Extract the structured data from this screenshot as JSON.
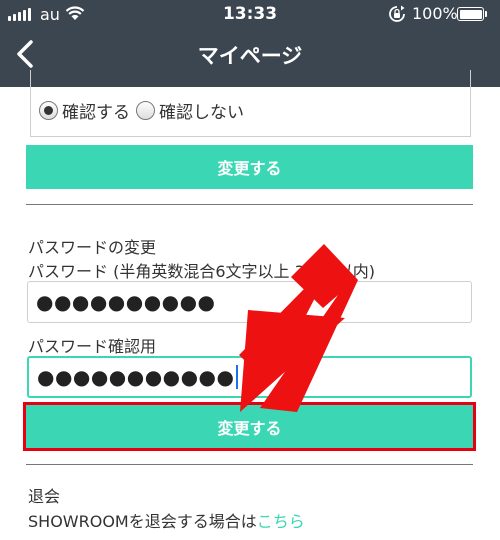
{
  "status_bar": {
    "carrier": "au",
    "time": "13:33",
    "battery": "100%"
  },
  "header": {
    "title": "マイページ"
  },
  "confirm_setting": {
    "options": [
      "確認する",
      "確認しない"
    ],
    "selected_index": 0
  },
  "buttons": {
    "change_label_1": "変更する",
    "change_label_2": "変更する"
  },
  "password_section": {
    "title": "パスワードの変更",
    "password_label": "パスワード (半角英数混合6文字以上 3文字以内)",
    "password_value": "●●●●●●●●●●",
    "confirm_label": "パスワード確認用",
    "confirm_value": "●●●●●●●●●●●"
  },
  "withdraw_section": {
    "title": "退会",
    "text": "SHOWROOMを退会する場合は",
    "link": "こちら"
  },
  "colors": {
    "header_bg": "#3c4650",
    "accent": "#3bd6b4",
    "highlight": "#e60012"
  }
}
